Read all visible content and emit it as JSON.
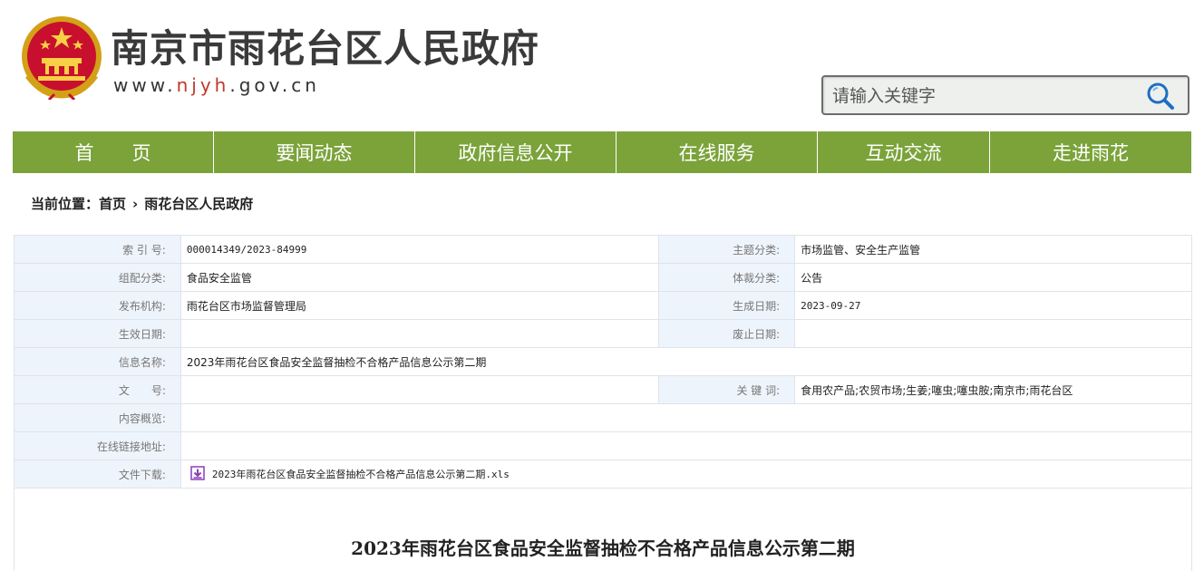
{
  "header": {
    "title": "南京市雨花台区人民政府",
    "url_prefix": "www.",
    "url_accent": "njyh",
    "url_suffix": ".gov.cn",
    "emblem_icon": "national-emblem-icon"
  },
  "search": {
    "placeholder": "请输入关键字",
    "icon": "search-icon"
  },
  "nav": {
    "color": "#7ba33a",
    "items": [
      {
        "label": "首　　页"
      },
      {
        "label": "要闻动态"
      },
      {
        "label": "政府信息公开"
      },
      {
        "label": "在线服务"
      },
      {
        "label": "互动交流"
      },
      {
        "label": "走进雨花"
      }
    ]
  },
  "breadcrumb": {
    "prefix": "当前位置：",
    "home": "首页",
    "separator": "›",
    "current": "雨花台区人民政府"
  },
  "meta": {
    "index_label": "索 引 号:",
    "index_value": "000014349/2023-84999",
    "topic_label": "主题分类:",
    "topic_value": "市场监管、安全生产监管",
    "category_label": "组配分类:",
    "category_value": "食品安全监管",
    "genre_label": "体裁分类:",
    "genre_value": "公告",
    "publisher_label": "发布机构:",
    "publisher_value": "雨花台区市场监督管理局",
    "created_label": "生成日期:",
    "created_value": "2023-09-27",
    "effective_label": "生效日期:",
    "effective_value": "",
    "expiry_label": "废止日期:",
    "expiry_value": "",
    "name_label": "信息名称:",
    "name_value": "2023年雨花台区食品安全监督抽检不合格产品信息公示第二期",
    "docno_label": "文　　号:",
    "docno_value": "",
    "keywords_label": "关 键 词:",
    "keywords_value": "食用农产品;农贸市场;生姜;噻虫;噻虫胺;南京市;雨花台区",
    "summary_label": "内容概览:",
    "summary_value": "",
    "link_label": "在线链接地址:",
    "link_value": "",
    "file_label": "文件下载:",
    "file_value": "2023年雨花台区食品安全监督抽检不合格产品信息公示第二期.xls",
    "file_icon": "download-icon"
  },
  "article": {
    "title": "2023年雨花台区食品安全监督抽检不合格产品信息公示第二期"
  }
}
